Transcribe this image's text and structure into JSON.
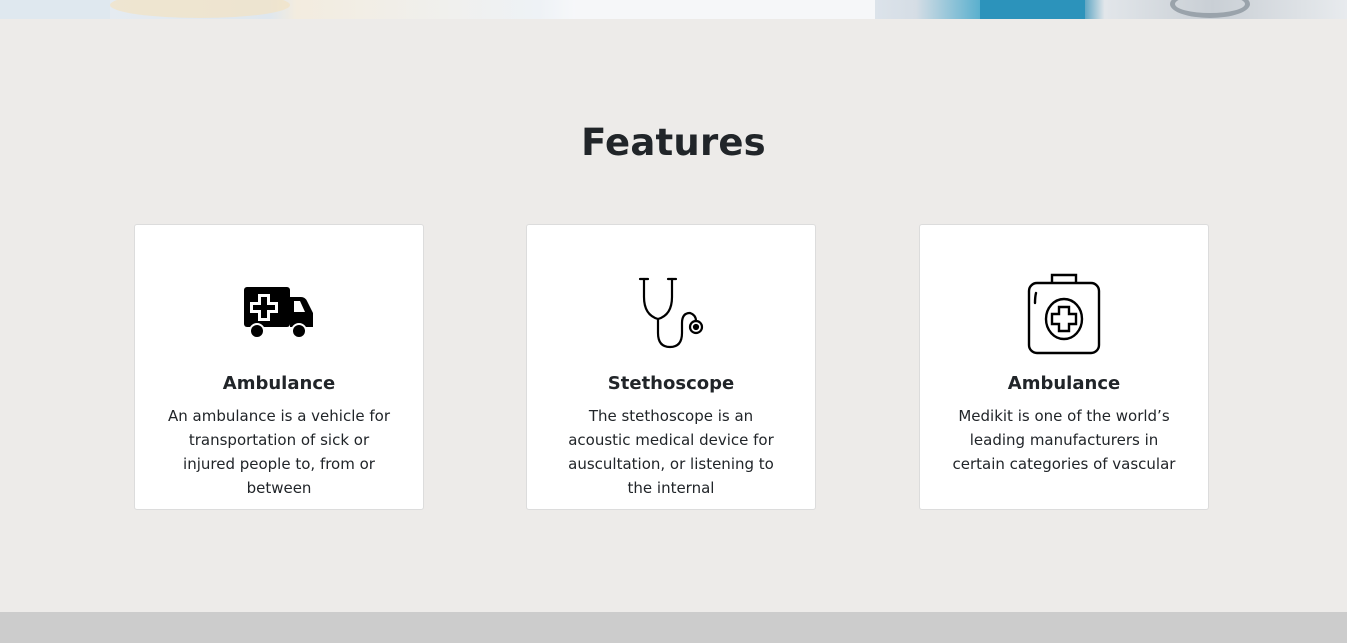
{
  "features": {
    "title": "Features",
    "cards": [
      {
        "icon": "ambulance-icon",
        "title": "Ambulance",
        "text": "An ambulance is a vehicle for transportation of sick or injured people to, from or between"
      },
      {
        "icon": "stethoscope-icon",
        "title": "Stethoscope",
        "text": "The stethoscope is an acoustic medical device for auscultation, or listening to the internal"
      },
      {
        "icon": "medical-kit-icon",
        "title": "Ambulance",
        "text": "Medikit is one of the world’s leading manufacturers in certain categories of vascular"
      }
    ]
  }
}
